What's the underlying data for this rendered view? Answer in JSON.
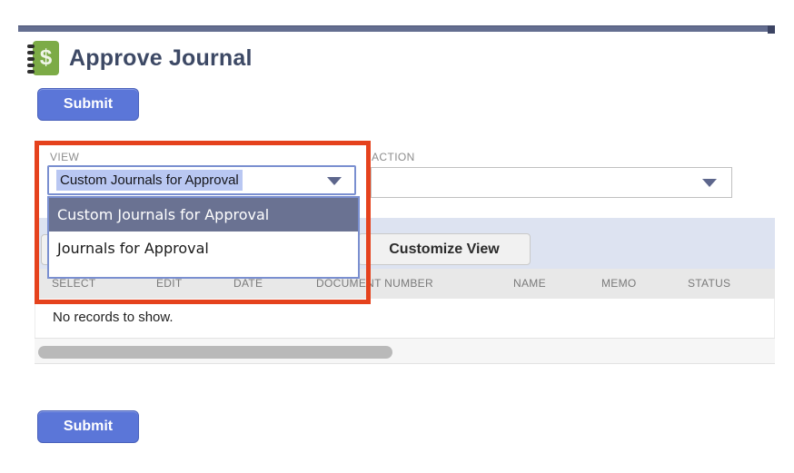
{
  "page": {
    "title": "Approve Journal"
  },
  "toolbar": {
    "submit_top_label": "Submit",
    "submit_bottom_label": "Submit",
    "customize_view_label": "Customize View"
  },
  "view_field": {
    "label": "VIEW",
    "value": "Custom Journals for Approval",
    "options": [
      "Custom Journals for Approval",
      "Journals for Approval"
    ],
    "selected_index": 0
  },
  "action_field": {
    "label": "ACTION",
    "value": ""
  },
  "table": {
    "columns": [
      "SELECT",
      "EDIT",
      "DATE",
      "DOCUMENT NUMBER",
      "NAME",
      "MEMO",
      "STATUS"
    ],
    "empty_message": "No records to show."
  },
  "icons": {
    "journal_icon_glyph": "$",
    "view_caret": "chevron-down",
    "action_caret": "chevron-down"
  },
  "colors": {
    "accent_blue": "#5b76d8",
    "topbar_slate": "#646e90",
    "topbar_cap": "#3c4463",
    "title_navy": "#3d4965",
    "icon_green": "#7cab46",
    "menu_highlight_slate": "#6a7292",
    "select_selection_highlight": "#b9c7f2",
    "focus_border_blue": "#7a8fd0",
    "annotation_red": "#e5421d",
    "toolbar_band_blue": "#dde3f1",
    "table_header_gray": "#e8e8e8",
    "scroll_thumb_gray": "#b9b9b9"
  }
}
